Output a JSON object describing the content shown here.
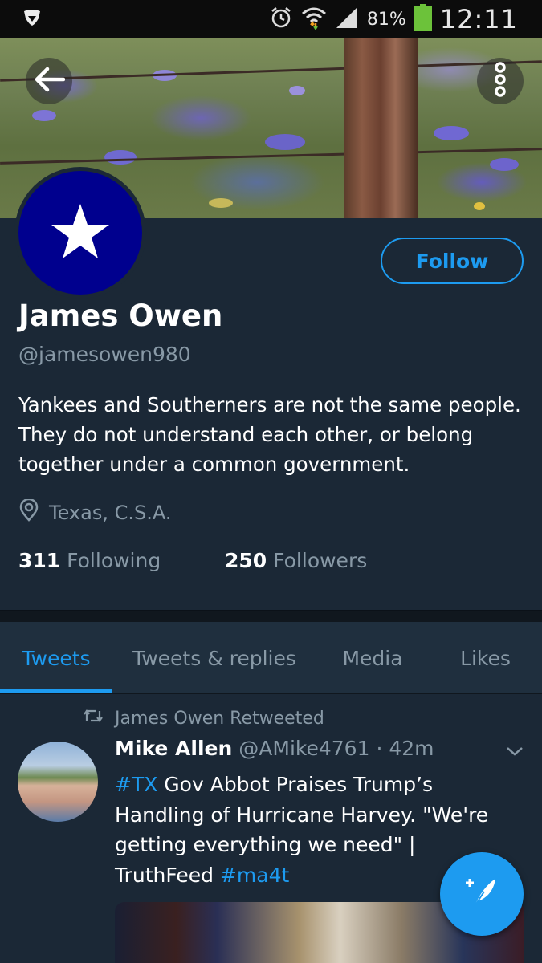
{
  "status_bar": {
    "battery_percent": "81%",
    "time": "12:11",
    "icons": [
      "app-shield-icon",
      "alarm-icon",
      "wifi-icon",
      "signal-icon",
      "battery-icon"
    ]
  },
  "header": {
    "back_icon": "back-arrow-icon",
    "more_icon": "more-vertical-icon"
  },
  "profile": {
    "follow_label": "Follow",
    "name": "James Owen",
    "handle": "@jamesowen980",
    "bio": "Yankees and Southerners are not the same people. They do not understand each other, or belong together under a common government.",
    "location": "Texas, C.S.A.",
    "following_count": "311",
    "following_label": "Following",
    "followers_count": "250",
    "followers_label": "Followers",
    "avatar_color": "#00008e"
  },
  "tabs": [
    {
      "label": "Tweets",
      "active": true
    },
    {
      "label": "Tweets & replies",
      "active": false
    },
    {
      "label": "Media",
      "active": false
    },
    {
      "label": "Likes",
      "active": false
    }
  ],
  "tweet": {
    "retweet_label": "James Owen Retweeted",
    "author_name": "Mike Allen",
    "author_handle": "@AMike4761",
    "separator": "·",
    "time": "42m",
    "text_hashtag": "#TX",
    "text_body": " Gov Abbot Praises Trump’s Handling of Hurricane Harvey.  \"We're getting everything we need\" | TruthFeed ",
    "text_hashtag2": "#ma4t"
  },
  "colors": {
    "accent": "#1d9bf0",
    "background": "#1b2836",
    "muted_text": "#8899a6"
  }
}
